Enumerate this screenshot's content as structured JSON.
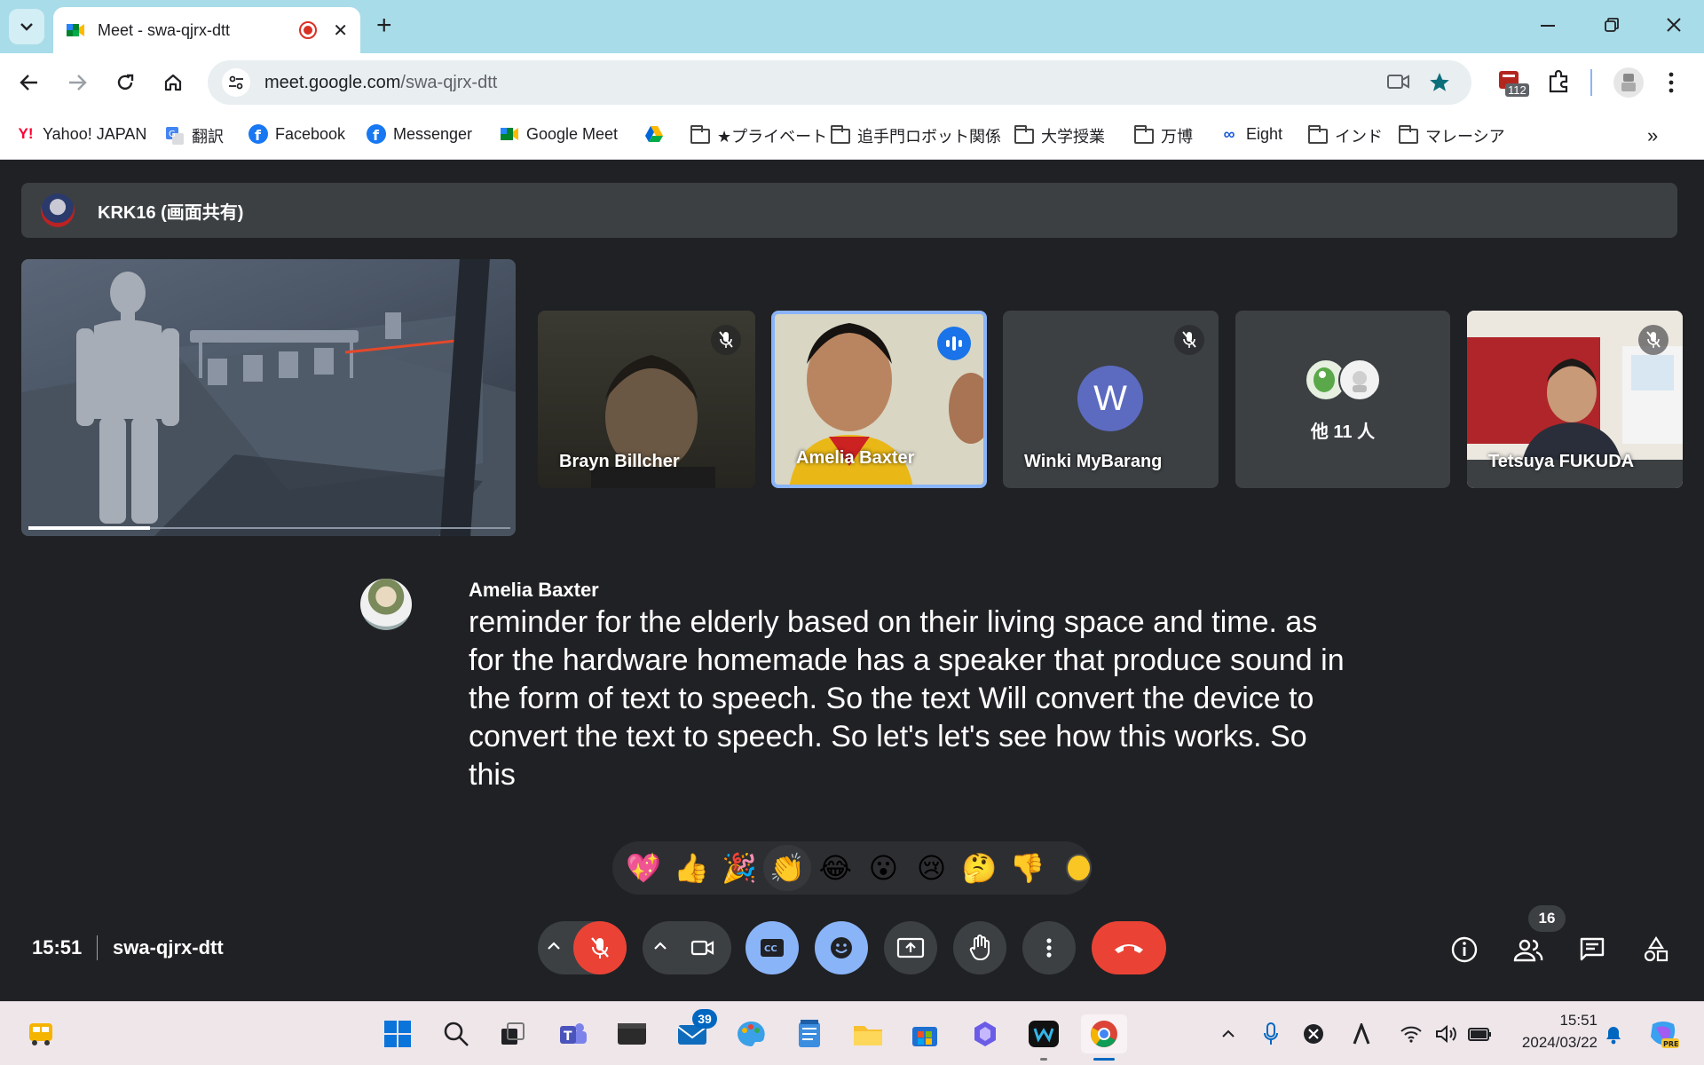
{
  "browser": {
    "tab_title": "Meet - swa-qjrx-dtt",
    "url_host": "meet.google.com",
    "url_path": "/swa-qjrx-dtt",
    "extension_badge": "112",
    "bookmarks": [
      {
        "label": "Yahoo! JAPAN",
        "icon": "yahoo-icon"
      },
      {
        "label": "翻訳",
        "icon": "translate-icon"
      },
      {
        "label": "Facebook",
        "icon": "facebook-icon"
      },
      {
        "label": "Messenger",
        "icon": "messenger-icon"
      },
      {
        "label": "Google Meet",
        "icon": "meet-icon"
      },
      {
        "label": "",
        "icon": "drive-icon"
      },
      {
        "label": "★プライベート",
        "icon": "folder-icon"
      },
      {
        "label": "追手門ロボット関係",
        "icon": "folder-icon"
      },
      {
        "label": "大学授業",
        "icon": "folder-icon"
      },
      {
        "label": "万博",
        "icon": "folder-icon"
      },
      {
        "label": "Eight",
        "icon": "eight-icon"
      },
      {
        "label": "インド",
        "icon": "folder-icon"
      },
      {
        "label": "マレーシア",
        "icon": "folder-icon"
      }
    ]
  },
  "meet": {
    "presenter": "KRK16 (画面共有)",
    "participants": [
      {
        "name": "Brayn Billcher",
        "muted": true
      },
      {
        "name": "Amelia Baxter",
        "muted": false,
        "speaking": true
      },
      {
        "name": "Winki MyBarang",
        "muted": true,
        "initial": "W"
      },
      {
        "name": "他 11 人"
      },
      {
        "name": "Tetsuya FUKUDA",
        "muted": true
      }
    ],
    "caption": {
      "speaker": "Amelia Baxter",
      "text": "reminder for the elderly based on their living space and time. as for the hardware homemade has a speaker that produce sound in the form of text to speech. So the text Will convert the device to convert the text to speech. So let's let's see how this works. So this"
    },
    "reactions": [
      "💖",
      "👍",
      "🎉",
      "👏",
      "😂",
      "😮",
      "😢",
      "🤔",
      "👎"
    ],
    "time": "15:51",
    "meeting_code": "swa-qjrx-dtt",
    "participant_count": "16"
  },
  "taskbar": {
    "mail_badge": "39",
    "time": "15:51",
    "date": "2024/03/22"
  },
  "colors": {
    "tab_strip": "#a8dce8",
    "meet_background": "#202124",
    "surface": "#3c4043",
    "leave_red": "#ea4335",
    "active_blue": "#8ab4f8"
  }
}
